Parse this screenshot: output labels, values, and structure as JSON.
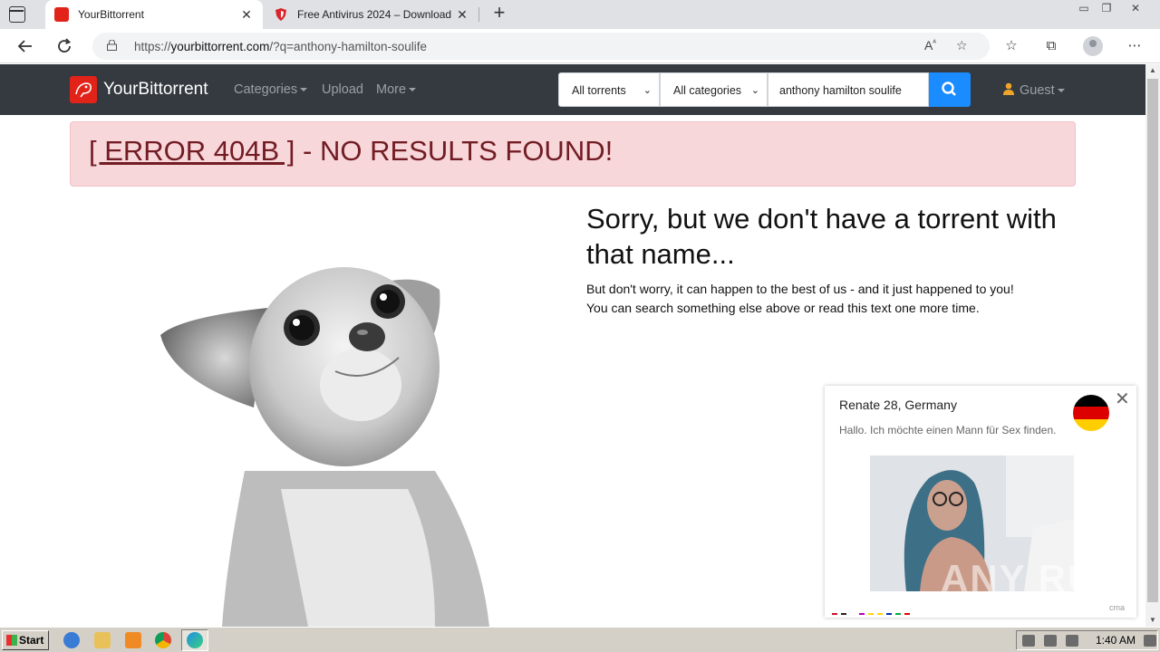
{
  "browser": {
    "tabs": [
      {
        "title": "YourBittorrent",
        "close": "✕",
        "icon": "red-square-favicon"
      },
      {
        "title": "Free Antivirus 2024 – Download",
        "close": "✕",
        "icon": "red-shield-favicon"
      }
    ],
    "new_tab": "+",
    "window_controls": [
      "▭",
      "❐",
      "✕"
    ],
    "url_prefix": "https://",
    "url_domain": "yourbittorrent.com",
    "url_path": "/?q=anthony-hamilton-soulife",
    "toolbar_icons": [
      "read-aloud-icon",
      "add-favorite-icon",
      "favorites-icon",
      "collections-icon",
      "profile-icon",
      "more-icon"
    ]
  },
  "site": {
    "brand": "YourBittorrent",
    "nav": {
      "categories": "Categories",
      "upload": "Upload",
      "more": "More"
    },
    "search": {
      "scope": "All torrents",
      "category": "All categories",
      "query": "anthony hamilton soulife"
    },
    "user": "Guest"
  },
  "content": {
    "error_code": "[ ERROR 404B ]",
    "error_rest": " - NO RESULTS FOUND!",
    "headline": "Sorry, but we don't have a torrent with that name...",
    "line1": "But don't worry, it can happen to the best of us - and it just happened to you!",
    "line2": "You can search something else above or read this text one more time."
  },
  "ad": {
    "name": "Renate 28, Germany",
    "message": "Hallo. Ich möchte einen Mann für Sex finden.",
    "close": "✕",
    "footer": "cma",
    "flag_colors": [
      "#000000",
      "#dd0000",
      "#ffce00"
    ]
  },
  "watermark": "ANY RUN",
  "taskbar": {
    "start": "Start",
    "time": "1:40 AM"
  }
}
